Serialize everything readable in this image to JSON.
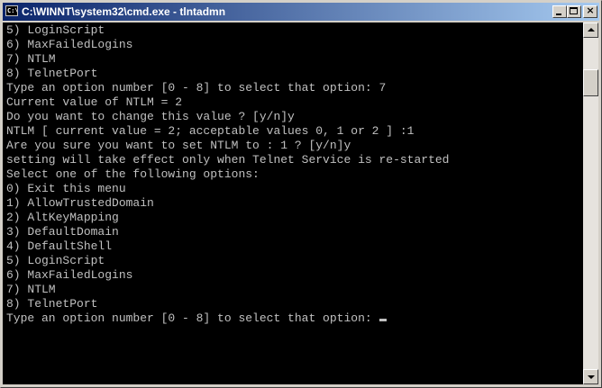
{
  "window": {
    "title": "C:\\WINNT\\system32\\cmd.exe - tlntadmn",
    "icon": "cmd-icon",
    "icon_glyph": "C:\\",
    "buttons": {
      "minimize": "minimize-icon",
      "maximize": "maximize-icon",
      "close": "close-icon",
      "close_glyph": "×"
    }
  },
  "console": {
    "lines": [
      "5) LoginScript",
      "6) MaxFailedLogins",
      "7) NTLM",
      "8) TelnetPort",
      "Type an option number [0 - 8] to select that option: 7",
      "Current value of NTLM = 2",
      "Do you want to change this value ? [y/n]y",
      "NTLM [ current value = 2; acceptable values 0, 1 or 2 ] :1",
      "Are you sure you want to set NTLM to : 1 ? [y/n]y",
      "",
      "setting will take effect only when Telnet Service is re-started",
      "",
      "",
      "Select one of the following options:",
      "",
      "0) Exit this menu",
      "1) AllowTrustedDomain",
      "2) AltKeyMapping",
      "3) DefaultDomain",
      "4) DefaultShell",
      "5) LoginScript",
      "6) MaxFailedLogins",
      "7) NTLM",
      "8) TelnetPort"
    ],
    "prompt": "Type an option number [0 - 8] to select that option: "
  },
  "colors": {
    "titlebar_start": "#0a246a",
    "titlebar_end": "#a6caf0",
    "console_bg": "#000000",
    "console_fg": "#c0c0c0",
    "chrome": "#d4d0c8"
  }
}
